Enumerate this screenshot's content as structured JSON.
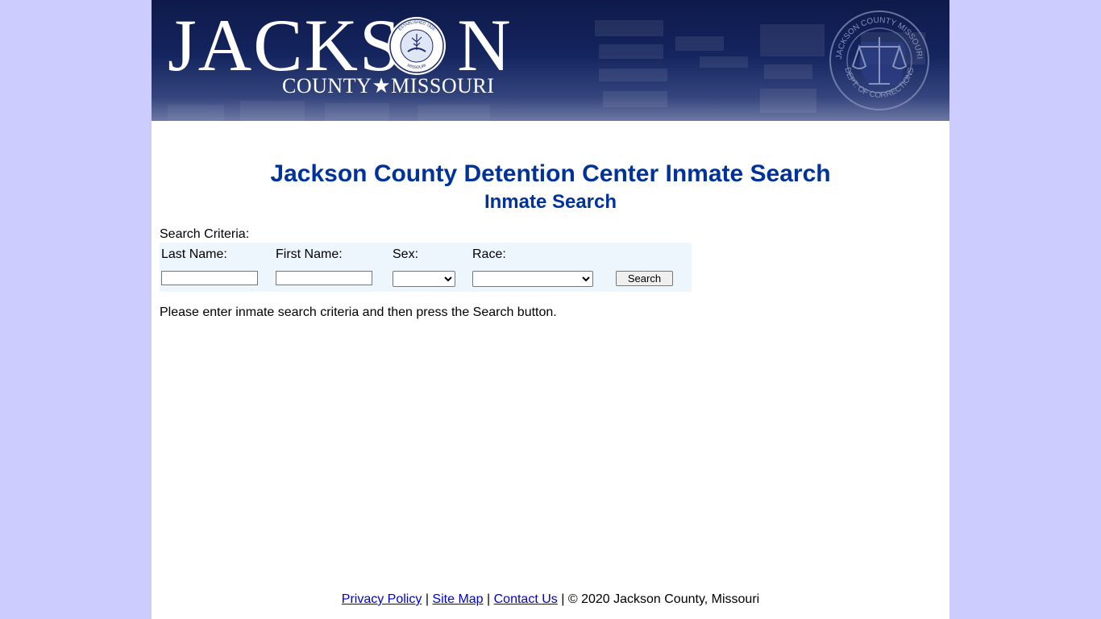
{
  "header": {
    "logo_word": "JACKS",
    "logo_word_tail": "N",
    "logo_subtitle": "COUNTY★MISSOURI",
    "county_seal": {
      "top": "ESTABLISHED 1826",
      "middle": "JACKSON COUNTY",
      "bottom": "MISSOURI"
    },
    "doc_seal": {
      "top": "JACKSON COUNTY MISSOURI",
      "bottom": "DEPT. OF CORRECTIONS"
    }
  },
  "page": {
    "title": "Jackson County Detention Center Inmate Search",
    "subtitle": "Inmate Search"
  },
  "search": {
    "criteria_label": "Search Criteria:",
    "last_name_label": "Last Name:",
    "first_name_label": "First Name:",
    "sex_label": "Sex:",
    "race_label": "Race:",
    "last_name_value": "",
    "first_name_value": "",
    "sex_selected": "",
    "race_selected": "",
    "search_button_label": "Search"
  },
  "instructions": "Please enter inmate search criteria and then press the Search button.",
  "footer": {
    "privacy_link": "Privacy Policy",
    "sitemap_link": "Site Map",
    "contact_link": "Contact Us",
    "separator": "|",
    "copyright": "© 2020 Jackson County, Missouri"
  },
  "colors": {
    "page_background": "#ccccff",
    "heading": "#003399",
    "search_panel": "#eef6fd",
    "banner": "#14245e",
    "link": "#0000cc"
  }
}
